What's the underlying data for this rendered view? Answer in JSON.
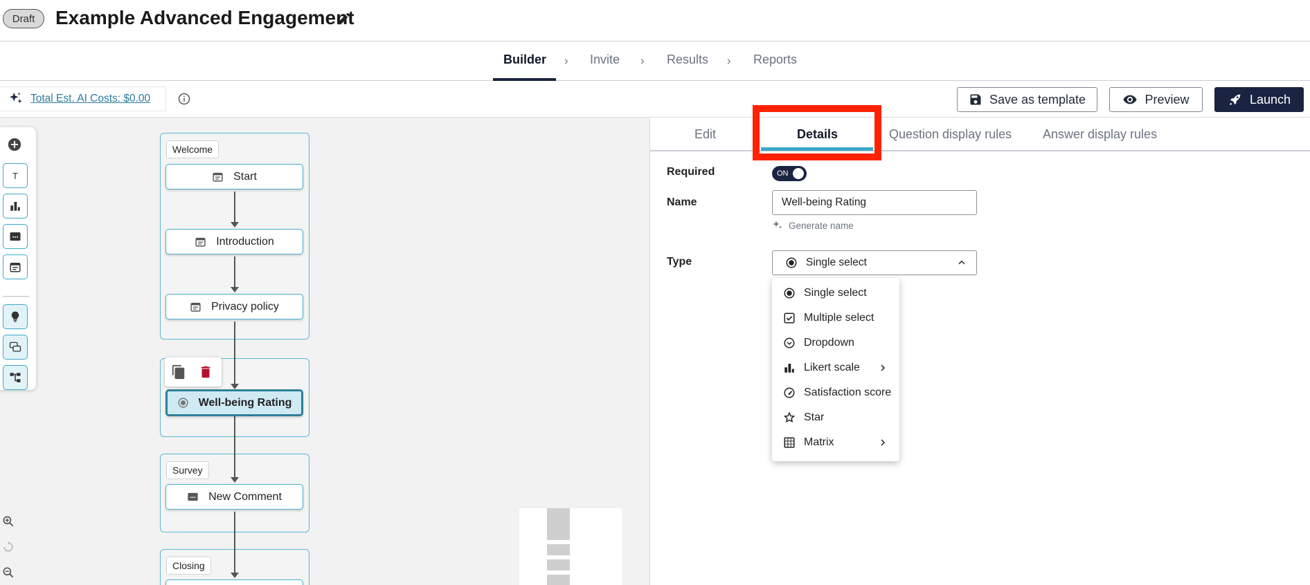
{
  "header": {
    "badge": "Draft",
    "title": "Example Advanced Engagement"
  },
  "steps": [
    "Builder",
    "Invite",
    "Results",
    "Reports"
  ],
  "steps_separator": "›",
  "toolbar": {
    "ai_cost": "Total Est. AI Costs: $0.00",
    "save_template": "Save as template",
    "preview": "Preview",
    "launch": "Launch"
  },
  "palette": {
    "text_tool": "T"
  },
  "flow": {
    "groups": {
      "welcome": "Welcome",
      "survey": "Survey",
      "closing": "Closing"
    },
    "nodes": {
      "start": "Start",
      "introduction": "Introduction",
      "privacy": "Privacy policy",
      "wellbeing": "Well-being Rating",
      "new_comment": "New Comment"
    }
  },
  "panel": {
    "tabs": [
      "Edit",
      "Details",
      "Question display rules",
      "Answer display rules"
    ],
    "required_label": "Required",
    "required_toggle": "ON",
    "name_label": "Name",
    "name_value": "Well-being Rating",
    "generate_name": "Generate name",
    "type_label": "Type",
    "type_value": "Single select",
    "type_options": [
      "Single select",
      "Multiple select",
      "Dropdown",
      "Likert scale",
      "Satisfaction score",
      "Star",
      "Matrix"
    ]
  },
  "colors": {
    "brand_dark": "#1a2440",
    "accent": "#3aa9c8",
    "highlight": "#ff2200",
    "delete": "#b3122e"
  }
}
